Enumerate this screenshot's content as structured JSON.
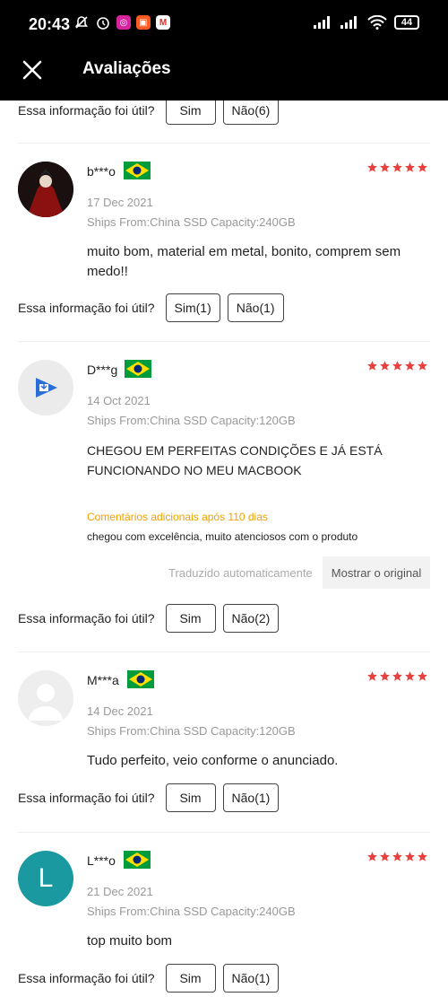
{
  "status_bar": {
    "time": "20:43",
    "battery": "44",
    "left_icons": [
      "mute-icon",
      "alarm-icon",
      "instagram-icon",
      "shop-icon",
      "gmail-icon"
    ],
    "right_icons": [
      "signal-icon",
      "signal-icon",
      "wifi-icon",
      "battery-icon"
    ]
  },
  "header": {
    "title": "Avaliações",
    "close_icon": "close-icon"
  },
  "helpful_label": "Essa informação foi útil?",
  "top_partial": {
    "yes": "Sim",
    "no": "Não(6)"
  },
  "reviews": [
    {
      "user": "b***o",
      "date": "17 Dec 2021",
      "specs": "Ships From:China SSD Capacity:240GB",
      "text": "muito bom, material em metal, bonito,  comprem sem medo!!",
      "rating": 5,
      "yes": "Sim(1)",
      "no": "Não(1)"
    },
    {
      "user": "D***g",
      "date": "14 Oct 2021",
      "specs": "Ships From:China SSD Capacity:120GB",
      "text": "CHEGOU EM PERFEITAS CONDIÇÕES E JÁ ESTÁ FUNCIONANDO NO MEU MACBOOK",
      "additional_label": "Comentários adicionais após 110 dias",
      "additional_text": "chegou com excelência, muito atenciosos com o produto",
      "translated_label": "Traduzido automaticamente",
      "show_original": "Mostrar o original",
      "rating": 5,
      "yes": "Sim",
      "no": "Não(2)"
    },
    {
      "user": "M***a",
      "date": "14 Dec 2021",
      "specs": "Ships From:China SSD Capacity:120GB",
      "text": "Tudo perfeito, veio conforme o anunciado.",
      "rating": 5,
      "yes": "Sim",
      "no": "Não(1)"
    },
    {
      "user": "L***o",
      "avatar_letter": "L",
      "date": "21 Dec 2021",
      "specs": "Ships From:China SSD Capacity:240GB",
      "text": "top muito bom",
      "rating": 5,
      "yes": "Sim",
      "no": "Não(1)"
    }
  ],
  "colors": {
    "header_bg": "#000000",
    "star": "#e9413f",
    "additional_label": "#f0a000",
    "avatar_l": "#1a9aa0"
  }
}
